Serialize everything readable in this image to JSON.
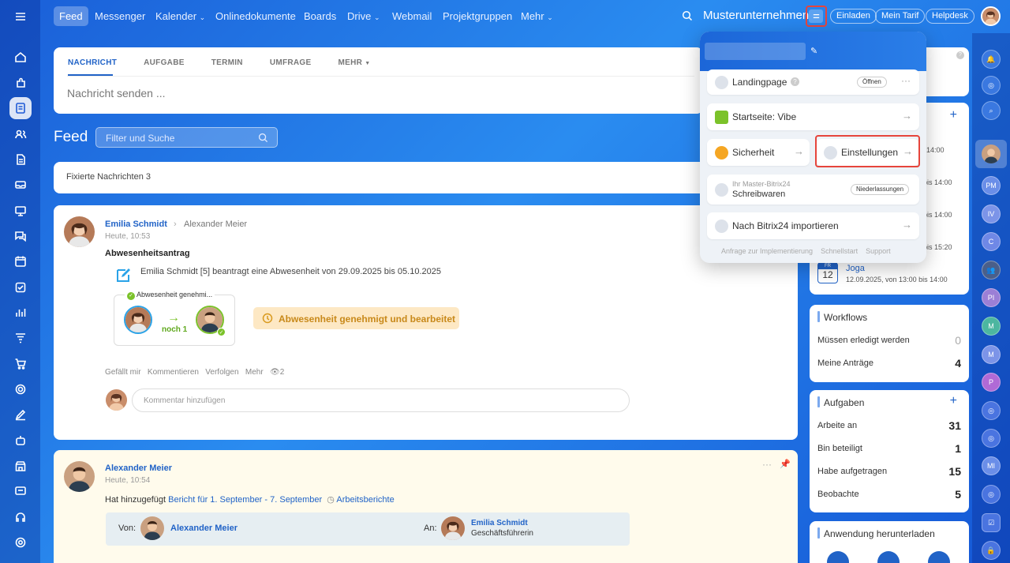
{
  "top_nav": {
    "items": [
      "Feed",
      "Messenger",
      "Kalender",
      "Onlinedokumente",
      "Boards",
      "Drive",
      "Webmail",
      "Projektgruppen",
      "Mehr"
    ],
    "company": "Musterunternehmen",
    "buttons": [
      "Einladen",
      "Mein Tarif",
      "Helpdesk"
    ]
  },
  "composer": {
    "tabs": [
      "NACHRICHT",
      "AUFGABE",
      "TERMIN",
      "UMFRAGE",
      "MEHR"
    ],
    "placeholder": "Nachricht senden ..."
  },
  "feed": {
    "title": "Feed",
    "filter_placeholder": "Filter und Suche",
    "pinned_label": "Fixierte Nachrichten",
    "pinned_count": "3"
  },
  "post1": {
    "author": "Emilia Schmidt",
    "recipient": "Alexander Meier",
    "time": "Heute, 10:53",
    "title": "Abwesenheitsantrag",
    "text": "Emilia Schmidt [5] beantragt eine Abwesenheit von 29.09.2025 bis 05.10.2025",
    "approval_label": "Abwesenheit genehmi...",
    "next_label": "noch 1",
    "status": "Abwesenheit genehmigt und bearbeitet",
    "actions": [
      "Gefällt mir",
      "Kommentieren",
      "Verfolgen",
      "Mehr"
    ],
    "views": "2",
    "comment_placeholder": "Kommentar hinzufügen"
  },
  "post2": {
    "author": "Alexander Meier",
    "time": "Heute, 10:54",
    "added_prefix": "Hat hinzugefügt",
    "report": "Bericht für 1. September - 7. September",
    "reports_label": "Arbeitsberichte",
    "from_label": "Von:",
    "from_name": "Alexander Meier",
    "to_label": "An:",
    "to_name": "Emilia Schmidt",
    "to_role": "Geschäftsführerin"
  },
  "popup": {
    "landing": "Landingpage",
    "open": "Öffnen",
    "start": "Startseite: Vibe",
    "security": "Sicherheit",
    "settings": "Einstellungen",
    "master_label": "Ihr Master-Bitrix24",
    "master_name": "Schreibwaren",
    "branches": "Niederlassungen",
    "import": "Nach Bitrix24 importieren",
    "footer": [
      "Anfrage zur Implementierung",
      "Schnellstart",
      "Support"
    ]
  },
  "calendar": {
    "times": [
      "14:00",
      "bis 14:00",
      "bis 14:00",
      "bis 15:20"
    ],
    "event_day": "12",
    "event_weekday": "FR",
    "event_title": "Joga",
    "event_time": "12.09.2025, von 13:00 bis 14:00"
  },
  "workflows": {
    "title": "Workflows",
    "rows": [
      {
        "label": "Müssen erledigt werden",
        "value": "0"
      },
      {
        "label": "Meine Anträge",
        "value": "4"
      }
    ]
  },
  "tasks": {
    "title": "Aufgaben",
    "rows": [
      {
        "label": "Arbeite an",
        "value": "31"
      },
      {
        "label": "Bin beteiligt",
        "value": "1"
      },
      {
        "label": "Habe aufgetragen",
        "value": "15"
      },
      {
        "label": "Beobachte",
        "value": "5"
      }
    ]
  },
  "download": {
    "title": "Anwendung herunterladen"
  },
  "right_avatars": [
    "PM",
    "IV",
    "C",
    "PI",
    "M",
    "M",
    "P",
    "MI"
  ]
}
